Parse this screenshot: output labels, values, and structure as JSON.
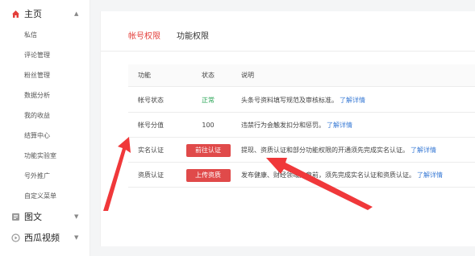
{
  "sidebar": {
    "home": {
      "label": "主页",
      "icon": "home-icon"
    },
    "items": [
      {
        "label": "私信"
      },
      {
        "label": "评论管理"
      },
      {
        "label": "粉丝管理"
      },
      {
        "label": "数据分析"
      },
      {
        "label": "我的收益"
      },
      {
        "label": "结算中心"
      },
      {
        "label": "功能实验室"
      },
      {
        "label": "号外推广"
      },
      {
        "label": "自定义菜单"
      }
    ],
    "groups": [
      {
        "label": "图文",
        "icon": "article-icon"
      },
      {
        "label": "西瓜视频",
        "icon": "video-icon"
      }
    ]
  },
  "tabs": [
    {
      "label": "帐号权限",
      "active": true
    },
    {
      "label": "功能权限",
      "active": false
    }
  ],
  "table": {
    "headers": {
      "func": "功能",
      "status": "状态",
      "desc": "说明"
    },
    "rows": [
      {
        "func": "帐号状态",
        "status": "正常",
        "desc": "头条号资料填写规范及审核标准。",
        "link": "了解详情"
      },
      {
        "func": "帐号分值",
        "status": "100",
        "desc": "违禁行为会触发扣分和惩罚。",
        "link": "了解详情"
      },
      {
        "func": "实名认证",
        "button": "前往认证",
        "desc": "提现、资质认证和部分功能权限的开通须先完成实名认证。",
        "link": "了解详情"
      },
      {
        "func": "资质认证",
        "button": "上传资质",
        "desc": "发布健康、财经领域文章前，须先完成实名认证和资质认证。",
        "link": "了解详情"
      }
    ]
  },
  "colors": {
    "accent": "#e33e3a",
    "button": "#e04a4a",
    "link": "#3a7bd5",
    "ok": "#2aa556",
    "arrow": "#f0383a"
  }
}
